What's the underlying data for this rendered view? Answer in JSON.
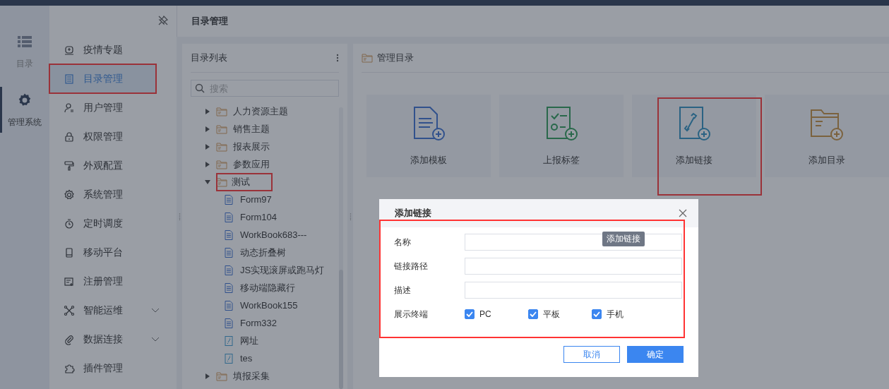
{
  "rail": [
    {
      "label": "目录",
      "selected": false
    },
    {
      "label": "管理系统",
      "selected": true
    }
  ],
  "nav": [
    {
      "label": "疫情专题",
      "selected": false,
      "highlighted": false,
      "has_submenu": false
    },
    {
      "label": "目录管理",
      "selected": true,
      "highlighted": true,
      "has_submenu": false
    },
    {
      "label": "用户管理",
      "selected": false,
      "highlighted": false,
      "has_submenu": false
    },
    {
      "label": "权限管理",
      "selected": false,
      "highlighted": false,
      "has_submenu": false
    },
    {
      "label": "外观配置",
      "selected": false,
      "highlighted": false,
      "has_submenu": false
    },
    {
      "label": "系统管理",
      "selected": false,
      "highlighted": false,
      "has_submenu": false
    },
    {
      "label": "定时调度",
      "selected": false,
      "highlighted": false,
      "has_submenu": false
    },
    {
      "label": "移动平台",
      "selected": false,
      "highlighted": false,
      "has_submenu": false
    },
    {
      "label": "注册管理",
      "selected": false,
      "highlighted": false,
      "has_submenu": false
    },
    {
      "label": "智能运维",
      "selected": false,
      "highlighted": false,
      "has_submenu": true
    },
    {
      "label": "数据连接",
      "selected": false,
      "highlighted": false,
      "has_submenu": true
    },
    {
      "label": "插件管理",
      "selected": false,
      "highlighted": false,
      "has_submenu": false
    }
  ],
  "page_title": "目录管理",
  "tree_panel": {
    "title": "目录列表",
    "search": {
      "placeholder": "搜索"
    },
    "items": [
      {
        "label": "人力资源主题",
        "kind": "folder",
        "expanded": false,
        "highlighted": false
      },
      {
        "label": "销售主题",
        "kind": "folder",
        "expanded": false,
        "highlighted": false
      },
      {
        "label": "报表展示",
        "kind": "folder",
        "expanded": false,
        "highlighted": false
      },
      {
        "label": "参数应用",
        "kind": "folder",
        "expanded": false,
        "highlighted": false
      },
      {
        "label": "测试",
        "kind": "folder",
        "expanded": true,
        "highlighted": true,
        "children": [
          {
            "label": "Form97",
            "kind": "report",
            "highlighted": false
          },
          {
            "label": "Form104",
            "kind": "report",
            "highlighted": false
          },
          {
            "label": "WorkBook683---",
            "kind": "report",
            "highlighted": false
          },
          {
            "label": "动态折叠树",
            "kind": "report",
            "highlighted": false
          },
          {
            "label": "JS实现滚屏或跑马灯",
            "kind": "report",
            "highlighted": false
          },
          {
            "label": "移动端隐藏行",
            "kind": "report",
            "highlighted": false
          },
          {
            "label": "WorkBook155",
            "kind": "report",
            "highlighted": false
          },
          {
            "label": "Form332",
            "kind": "report",
            "highlighted": false
          },
          {
            "label": "网址",
            "kind": "link",
            "highlighted": false
          },
          {
            "label": "tes",
            "kind": "link",
            "highlighted": false
          }
        ]
      },
      {
        "label": "填报采集",
        "kind": "folder",
        "expanded": false,
        "highlighted": false
      }
    ]
  },
  "manage_panel": {
    "title": "管理目录",
    "actions": [
      {
        "label": "添加模板",
        "kind": "template",
        "highlighted": false
      },
      {
        "label": "上报标签",
        "kind": "tag",
        "highlighted": false
      },
      {
        "label": "添加链接",
        "kind": "link",
        "highlighted": true
      },
      {
        "label": "添加目录",
        "kind": "folder",
        "highlighted": false
      }
    ]
  },
  "dialog": {
    "title": "添加链接",
    "tooltip": "添加链接",
    "highlighted": true,
    "fields": [
      {
        "label": "名称"
      },
      {
        "label": "链接路径"
      },
      {
        "label": "描述"
      }
    ],
    "terminals": {
      "label": "展示终端",
      "options": [
        {
          "label": "PC",
          "checked": true
        },
        {
          "label": "平板",
          "checked": true
        },
        {
          "label": "手机",
          "checked": true
        }
      ]
    },
    "buttons": [
      {
        "label": "取消",
        "kind": "secondary"
      },
      {
        "label": "确定",
        "kind": "primary"
      }
    ]
  }
}
